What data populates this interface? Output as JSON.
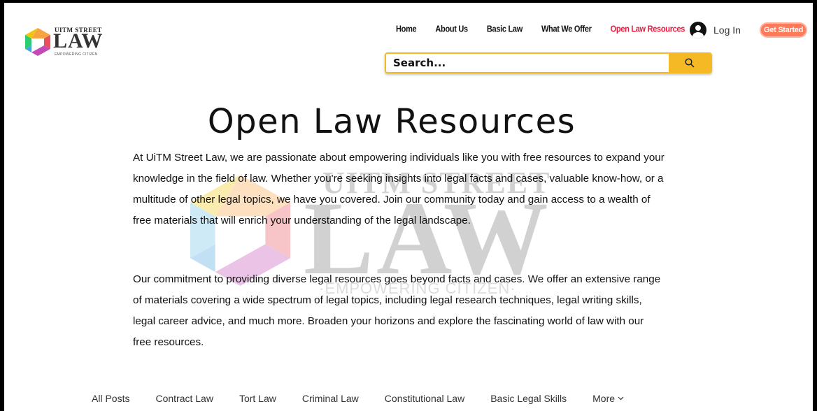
{
  "brand": {
    "top": "UITM STREET",
    "main": "LAW",
    "sub": "EMPOWERING CITIZEN"
  },
  "nav": {
    "items": [
      {
        "label": "Home",
        "active": false
      },
      {
        "label": "About Us",
        "active": false
      },
      {
        "label": "Basic Law",
        "active": false
      },
      {
        "label": "What We Offer",
        "active": false
      },
      {
        "label": "Open Law Resources",
        "active": true
      }
    ],
    "login_label": "Log In",
    "cta_label": "Get Started"
  },
  "search": {
    "placeholder": "Search..."
  },
  "watermark": {
    "top": "UITM STREET",
    "main": "LAW",
    "sub": "·EMPOWERING CITIZEN·"
  },
  "page": {
    "title": "Open Law Resources",
    "paragraph1": "At UiTM Street Law, we are passionate about empowering individuals like you with free resources to expand your knowledge in the field of law. Whether you're seeking insights into legal facts and cases, valuable know-how, or a multitude of other legal topics, we have you covered. Join our community today and gain access to a wealth of free materials that will enrich your understanding of the legal landscape.",
    "paragraph2": "Our commitment to providing diverse legal resources goes beyond facts and cases. We offer an extensive range of materials covering a wide spectrum of legal topics, including legal research techniques, legal writing skills, legal career advice, and much more. Broaden your horizons and explore the fascinating world of law with our free resources."
  },
  "categories": {
    "items": [
      "All Posts",
      "Contract Law",
      "Tort Law",
      "Criminal Law",
      "Constitutional Law",
      "Basic Legal Skills"
    ],
    "more_label": "More"
  },
  "colors": {
    "active_nav": "#e8193c",
    "search_accent": "#f5b925",
    "cta": "#ff7a59"
  },
  "icons": {
    "search": "search-icon",
    "account": "account-icon",
    "more": "chevron-down-icon"
  }
}
